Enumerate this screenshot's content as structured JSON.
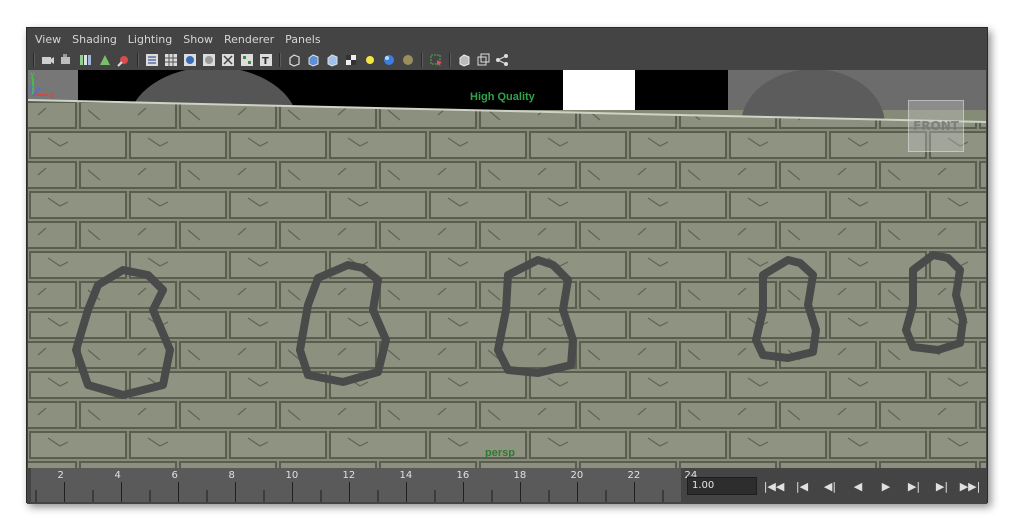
{
  "menus": [
    "View",
    "Shading",
    "Lighting",
    "Show",
    "Renderer",
    "Panels"
  ],
  "toolbar_icons": [
    "camera-select-icon",
    "camera-attributes-icon",
    "bookmarks-icon",
    "image-plane-icon",
    "2d-pan-zoom-icon",
    "wireframe-icon",
    "grid-icon",
    "smooth-shade-icon",
    "default-material-icon",
    "xray-icon",
    "texture-icon",
    "isolate-icon",
    "cube-wire-icon",
    "cube-shaded-icon",
    "cube-textured-icon",
    "checker-icon",
    "light-sphere-icon",
    "shadow-sphere-icon",
    "ambient-occlusion-icon",
    "select-camera-icon",
    "cube-outline-icon",
    "panel-icon",
    "share-icon"
  ],
  "viewport": {
    "renderer_label": "High Quality",
    "camera_label": "persp",
    "viewcube_label": "FRONT",
    "axis": {
      "y": "y",
      "x": "x",
      "z": "z"
    }
  },
  "timeline": {
    "ticks": [
      "2",
      "4",
      "6",
      "8",
      "10",
      "12",
      "14",
      "16",
      "18",
      "20",
      "22",
      "24"
    ],
    "current_frame": "1.00"
  },
  "playback_buttons": [
    {
      "name": "go-to-start-button",
      "glyph": "|◀◀"
    },
    {
      "name": "step-back-key-button",
      "glyph": "|◀"
    },
    {
      "name": "step-back-frame-button",
      "glyph": "◀|"
    },
    {
      "name": "play-backward-button",
      "glyph": "◀"
    },
    {
      "name": "play-forward-button",
      "glyph": "▶"
    },
    {
      "name": "step-forward-frame-button",
      "glyph": "▶|"
    },
    {
      "name": "step-forward-key-button",
      "glyph": "▶|"
    },
    {
      "name": "go-to-end-button",
      "glyph": "▶▶|"
    }
  ]
}
